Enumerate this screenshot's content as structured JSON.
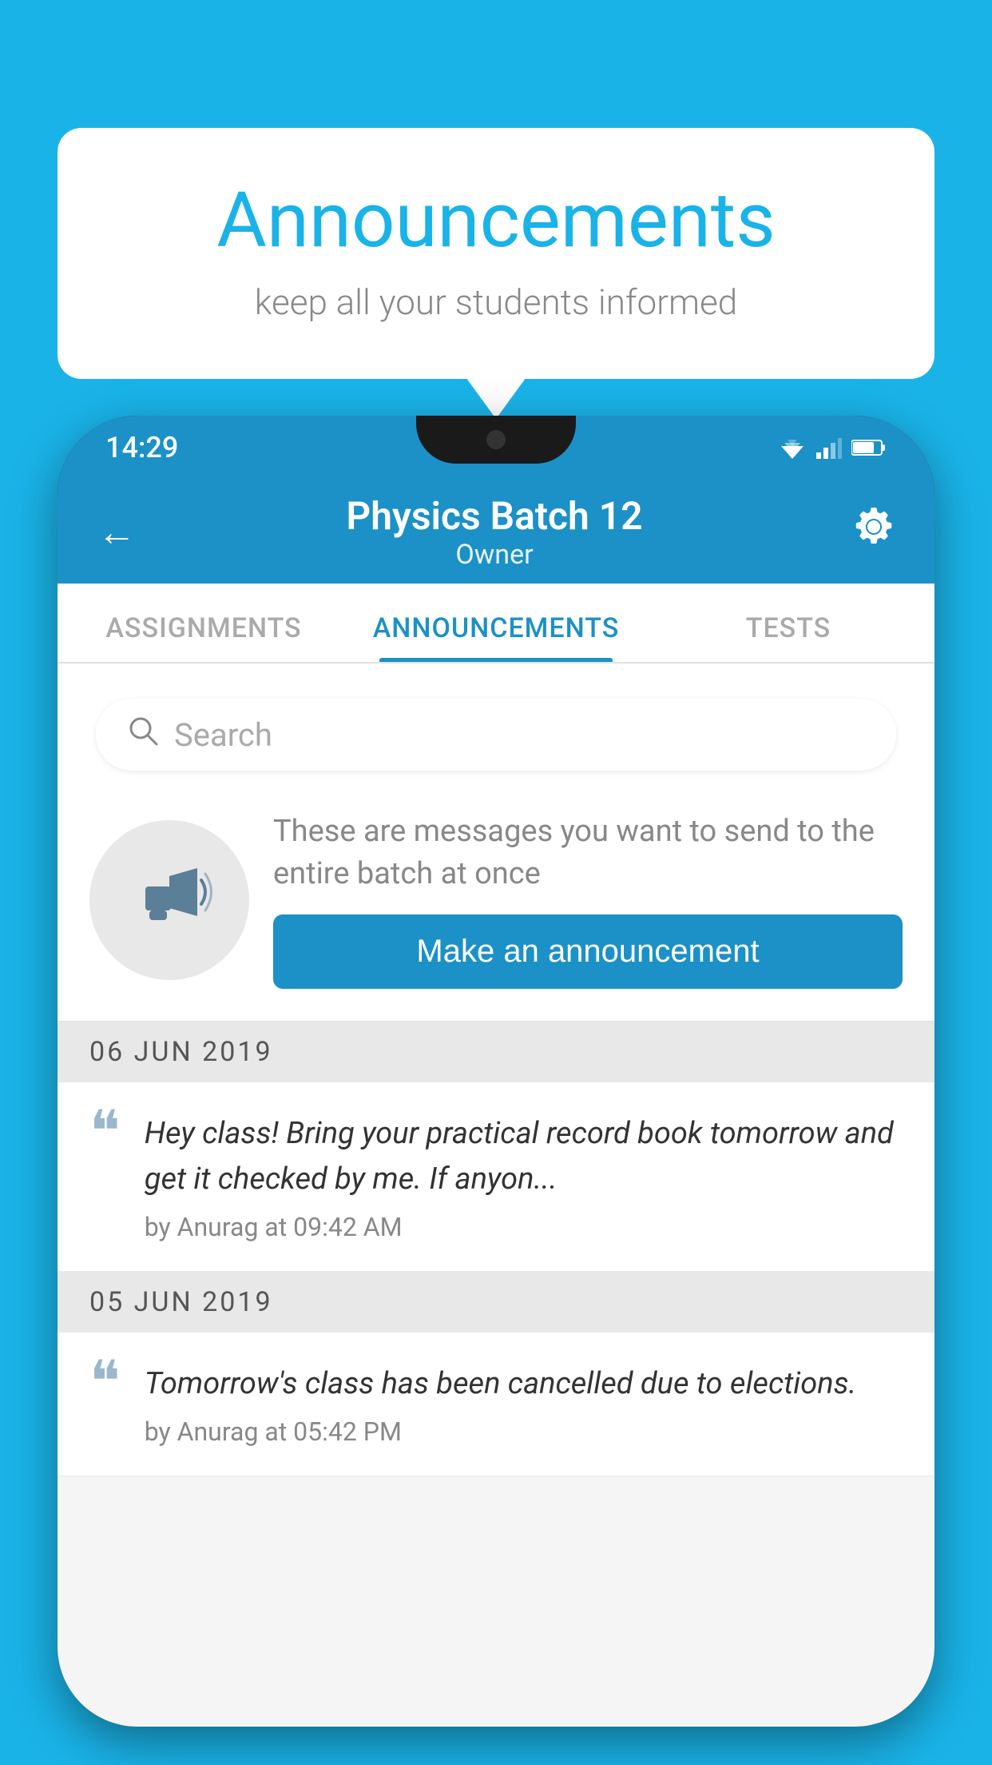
{
  "background": {
    "color": "#1ab3e8"
  },
  "speech_bubble": {
    "title": "Announcements",
    "subtitle": "keep all your students informed"
  },
  "status_bar": {
    "time": "14:29"
  },
  "app_bar": {
    "batch_name": "Physics Batch 12",
    "role": "Owner"
  },
  "tabs": [
    {
      "label": "ASSIGNMENTS",
      "active": false
    },
    {
      "label": "ANNOUNCEMENTS",
      "active": true
    },
    {
      "label": "TESTS",
      "active": false
    }
  ],
  "search": {
    "placeholder": "Search"
  },
  "promo": {
    "description": "These are messages you want to send to the entire batch at once",
    "button_label": "Make an announcement"
  },
  "announcements": [
    {
      "date": "06  JUN  2019",
      "text": "Hey class! Bring your practical record book tomorrow and get it checked by me. If anyon...",
      "meta": "by Anurag at 09:42 AM"
    },
    {
      "date": "05  JUN  2019",
      "text": "Tomorrow's class has been cancelled due to elections.",
      "meta": "by Anurag at 05:42 PM"
    }
  ]
}
